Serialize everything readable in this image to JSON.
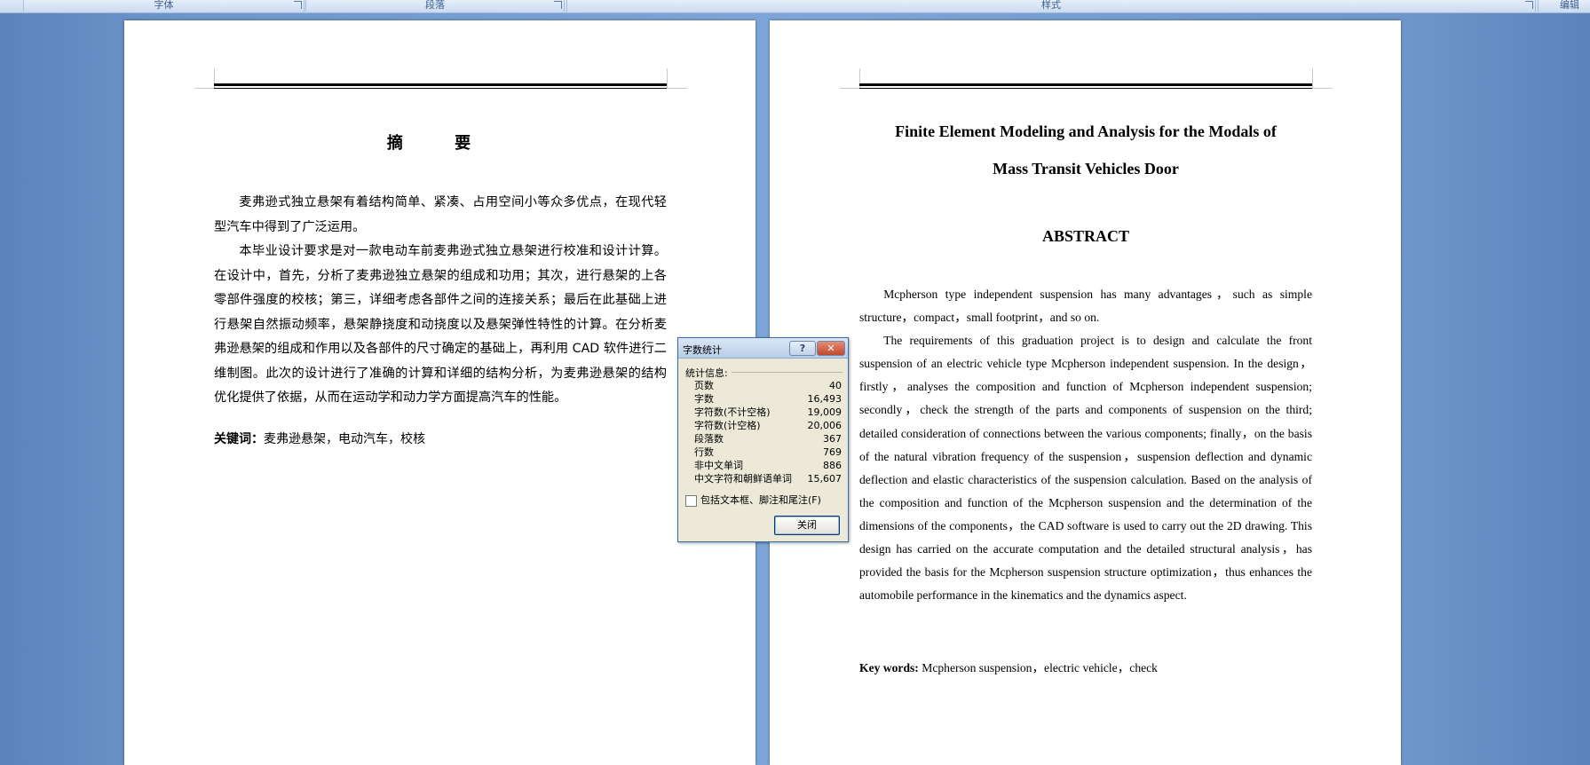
{
  "ribbon": {
    "groups": [
      "字体",
      "段落",
      "样式",
      "编辑"
    ]
  },
  "left_page": {
    "title": "摘 要",
    "paragraphs": [
      "麦弗逊式独立悬架有着结构简单、紧凑、占用空间小等众多优点，在现代轻型汽车中得到了广泛运用。",
      "本毕业设计要求是对一款电动车前麦弗逊式独立悬架进行校准和设计计算。在设计中，首先，分析了麦弗逊独立悬架的组成和功用；其次，进行悬架的上各零部件强度的校核；第三，详细考虑各部件之间的连接关系；最后在此基础上进行悬架自然振动频率，悬架静挠度和动挠度以及悬架弹性特性的计算。在分析麦弗逊悬架的组成和作用以及各部件的尺寸确定的基础上，再利用 CAD 软件进行二维制图。此次的设计进行了准确的计算和详细的结构分析，为麦弗逊悬架的结构优化提供了依据，从而在运动学和动力学方面提高汽车的性能。"
    ],
    "keywords_label": "关键词：",
    "keywords": "麦弗逊悬架，电动汽车，校核"
  },
  "right_page": {
    "title_line1": "Finite Element Modeling and Analysis for the Modals of",
    "title_line2": "Mass Transit Vehicles Door",
    "abstract_heading": "ABSTRACT",
    "paragraphs": [
      "Mcpherson type independent suspension has many advantages，such as simple structure，compact，small footprint，and so on.",
      "The requirements of this graduation project is to design and calculate the front suspension of an electric vehicle type Mcpherson independent suspension. In the design，firstly，analyses the composition and function of Mcpherson independent suspension; secondly，check the strength of the parts and components of suspension on the third; detailed consideration of connections between the various components; finally，on the basis of the natural vibration frequency of the suspension，suspension deflection and dynamic deflection and elastic characteristics of the suspension calculation. Based on the analysis of the composition and function of the Mcpherson suspension and the determination of the dimensions of the components，the CAD software is used to carry out the 2D drawing. This design has carried on the accurate computation and the detailed structural analysis，has provided the basis for the Mcpherson suspension structure optimization，thus enhances the automobile performance in the kinematics and the dynamics aspect."
    ],
    "keywords_label": "Key words:",
    "keywords": "Mcpherson suspension，electric vehicle，check"
  },
  "dialog": {
    "title": "字数统计",
    "help_glyph": "?",
    "close_glyph": "✕",
    "stats_heading": "统计信息:",
    "stats": [
      {
        "label": "页数",
        "value": "40"
      },
      {
        "label": "字数",
        "value": "16,493"
      },
      {
        "label": "字符数(不计空格)",
        "value": "19,009"
      },
      {
        "label": "字符数(计空格)",
        "value": "20,006"
      },
      {
        "label": "段落数",
        "value": "367"
      },
      {
        "label": "行数",
        "value": "769"
      },
      {
        "label": "非中文单词",
        "value": "886"
      },
      {
        "label": "中文字符和朝鲜语单词",
        "value": "15,607"
      }
    ],
    "checkbox_label": "包括文本框、脚注和尾注(F)",
    "checkbox_checked": false,
    "close_button": "关闭"
  }
}
